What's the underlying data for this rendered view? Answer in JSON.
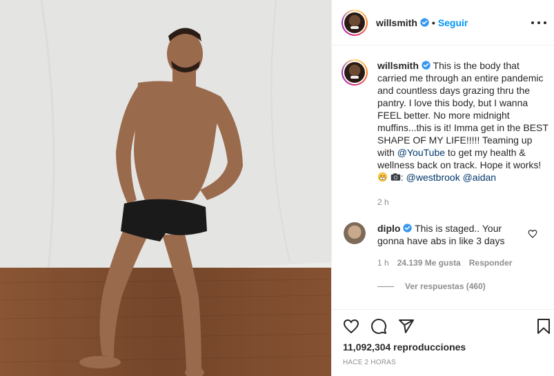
{
  "header": {
    "username": "willsmith",
    "separator": "•",
    "follow_label": "Seguir"
  },
  "caption": {
    "username": "willsmith",
    "text_before": "This is the body that carried me through an entire pandemic and countless days grazing thru the pantry. I love this body, but I wanna FEEL better. No more midnight muffins...this is it! Imma get in the BEST SHAPE OF MY LIFE!!!!! Teaming up with ",
    "mention_youtube": "@YouTube",
    "text_after": " to get my health & wellness back on track. Hope it works!",
    "photo_credit_sep": ":",
    "mention_westbrook": "@westbrook",
    "mention_aidan": "@aidan",
    "time": "2 h"
  },
  "comment": {
    "username": "diplo",
    "text": "This is staged.. Your gonna have abs in like 3 days",
    "time": "1 h",
    "likes": "24.139 Me gusta",
    "reply_label": "Responder",
    "view_replies": "Ver respuestas (460)"
  },
  "footer": {
    "views": "11,092,304 reproducciones",
    "timestamp": "HACE 2 HORAS"
  },
  "colors": {
    "accent": "#0095f6",
    "verified": "#3897f0",
    "mention": "#00376b",
    "muted": "#8e8e8e"
  },
  "icons": [
    "verified-badge-icon",
    "more-options-icon",
    "heart-icon",
    "comment-icon",
    "share-icon",
    "bookmark-icon",
    "grin-emoji-icon",
    "camera-emoji-icon"
  ]
}
